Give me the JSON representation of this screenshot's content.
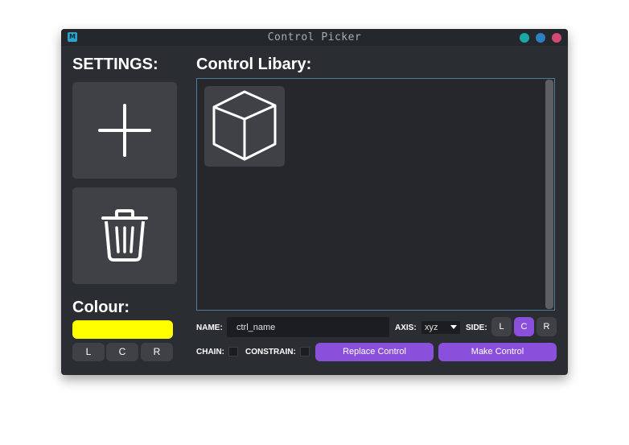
{
  "window": {
    "title": "Control Picker",
    "app_icon_label": "M",
    "controls": {
      "minimize_color": "#1aa7a6",
      "maximize_color": "#2d7fc0",
      "close_color": "#d04a74"
    }
  },
  "settings": {
    "heading": "SETTINGS:",
    "add_icon": "plus-icon",
    "delete_icon": "trash-icon"
  },
  "library": {
    "heading": "Control Libary:",
    "items": [
      {
        "icon": "cube-icon"
      }
    ]
  },
  "colour": {
    "heading": "Colour:",
    "swatch": "#ffff00",
    "side_buttons": [
      "L",
      "C",
      "R"
    ]
  },
  "form": {
    "name_label": "NAME:",
    "name_value": "ctrl_name",
    "axis_label": "AXIS:",
    "axis_value": "xyz",
    "side_label": "SIDE:",
    "side_options": [
      "L",
      "C",
      "R"
    ],
    "side_selected": "C",
    "chain_label": "CHAIN:",
    "constrain_label": "CONSTRAIN:",
    "replace_button": "Replace Control",
    "make_button": "Make Control"
  },
  "colors": {
    "accent": "#8a4fdb",
    "panel": "#2a2d32",
    "button": "#3f4146"
  }
}
